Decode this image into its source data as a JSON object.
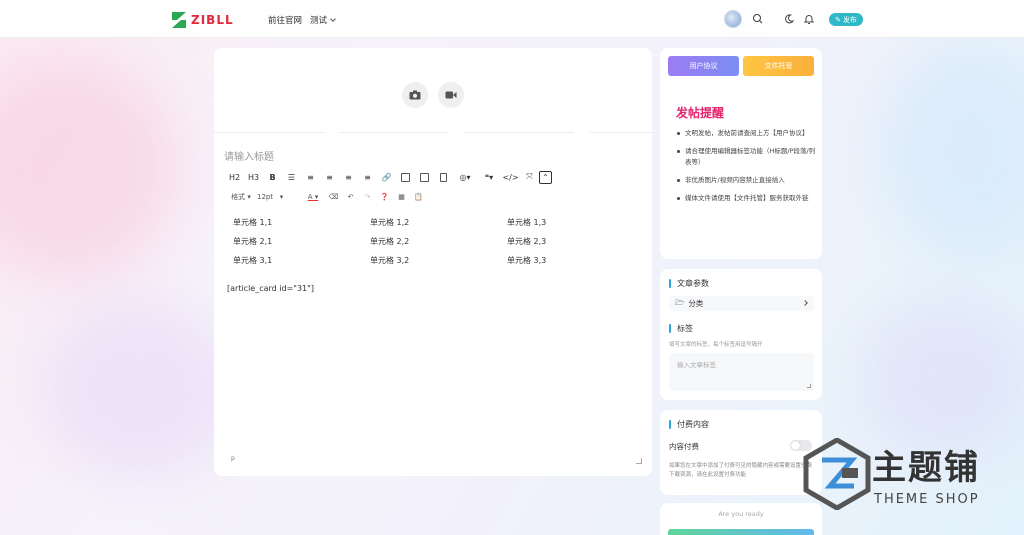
{
  "header": {
    "logo_text": "ZIBLL",
    "nav": [
      {
        "label": "前往官网"
      },
      {
        "label": "测试"
      }
    ],
    "publish_label": "发布"
  },
  "editor": {
    "title_placeholder": "请输入标题",
    "toolbar1": [
      "H2",
      "H3",
      "B"
    ],
    "toolbar2": {
      "format_label": "格式",
      "font_size": "12pt"
    },
    "table": [
      [
        "单元格 1,1",
        "单元格 1,2",
        "单元格 1,3"
      ],
      [
        "单元格 2,1",
        "单元格 2,2",
        "单元格 2,3"
      ],
      [
        "单元格 3,1",
        "单元格 3,2",
        "单元格 3,3"
      ]
    ],
    "shortcode": "[article_card id=\"31\"]",
    "path": "p"
  },
  "sidebar": {
    "agreement_label": "用户协议",
    "hosting_label": "文件托管",
    "remind_title": "发帖提醒",
    "tips": [
      "文明发帖，发帖前请查阅上方【用户协议】",
      "请合理使用编辑器标签功能（H标题/P段落/列表等）",
      "非优质图片/视频内容禁止直接插入",
      "媒体文件请使用【文件托管】服务获取外链"
    ],
    "params_title": "文章参数",
    "category_label": "分类",
    "tags_title": "标签",
    "tags_hint": "填写文章的标签，每个标签用逗号隔开",
    "tags_placeholder": "输入文章标签",
    "paid_title": "付费内容",
    "paid_toggle_label": "内容付费",
    "paid_desc": "如果您在文章中添加了付费可见的隐藏内容或需要设置付费下载资源，请在此设置付费功能",
    "ready_text": "Are you ready"
  },
  "watermark": {
    "cn": "主题铺",
    "en": "THEME SHOP"
  },
  "colors": {
    "accent": "#2fb8c6",
    "remind": "#e5266f",
    "logo": "#e4283d",
    "section_bar": "#2fa3dc"
  }
}
